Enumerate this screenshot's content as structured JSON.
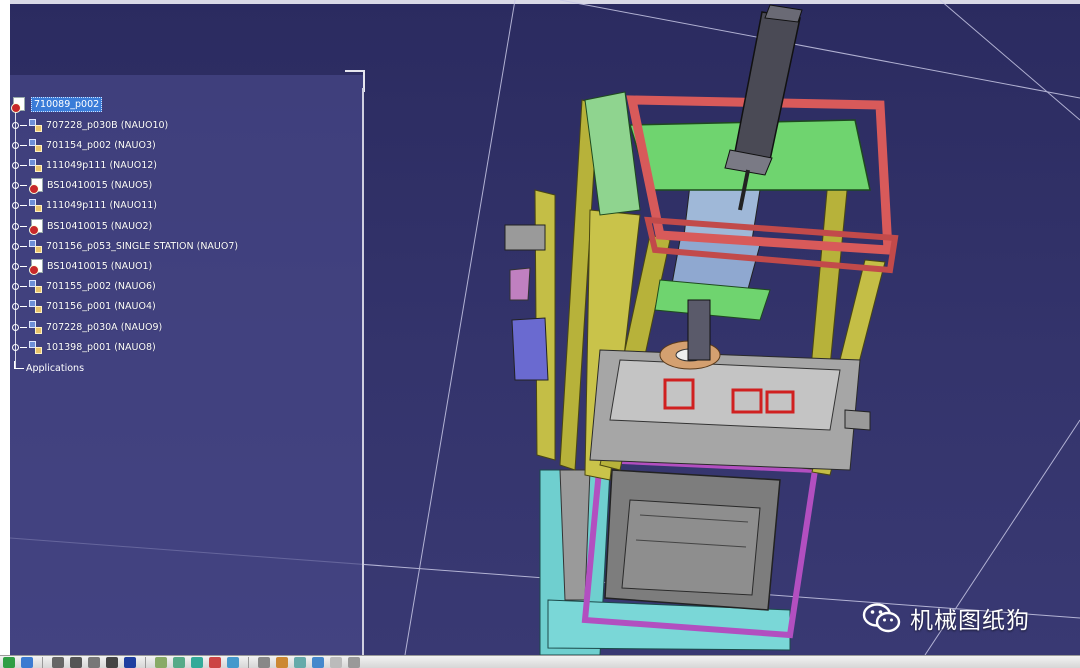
{
  "spec_tree": {
    "root": {
      "label": "710089_p002",
      "icon": "product-icon",
      "selected": true
    },
    "items": [
      {
        "label": "707228_p030B (NAUO10)",
        "icon": "part-icon"
      },
      {
        "label": "701154_p002 (NAUO3)",
        "icon": "part-icon"
      },
      {
        "label": "111049p111 (NAUO12)",
        "icon": "part-icon"
      },
      {
        "label": "BS10410015 (NAUO5)",
        "icon": "product-icon"
      },
      {
        "label": "111049p111 (NAUO11)",
        "icon": "part-icon"
      },
      {
        "label": "BS10410015 (NAUO2)",
        "icon": "product-icon"
      },
      {
        "label": "701156_p053_SINGLE STATION (NAUO7)",
        "icon": "part-icon"
      },
      {
        "label": "BS10410015 (NAUO1)",
        "icon": "product-icon"
      },
      {
        "label": "701155_p002 (NAUO6)",
        "icon": "part-icon"
      },
      {
        "label": "701156_p001 (NAUO4)",
        "icon": "part-icon"
      },
      {
        "label": "707228_p030A (NAUO9)",
        "icon": "part-icon"
      },
      {
        "label": "101398_p001 (NAUO8)",
        "icon": "part-icon"
      }
    ],
    "applications": "Applications"
  },
  "viewport": {
    "background": "#2f2f66",
    "model": "machine-assembly-3d-model",
    "frame_colors": {
      "top_frame": "#d85a5a",
      "left_frame": "#b7b23a",
      "right_frame": "#b7b23a",
      "top_plate": "#6fd46f",
      "base": "#5ac4c4",
      "lower_frame": "#b24fc0",
      "box": "#8a8a8a"
    }
  },
  "toolbar": {
    "icons": [
      "compass-icon",
      "fit-all-icon",
      "pan-icon",
      "rotate-icon",
      "zoom-in-icon",
      "zoom-out-icon",
      "normal-view-icon",
      "multi-view-icon",
      "iso-view-icon",
      "shading-icon",
      "hide-show-icon",
      "swap-visible-icon",
      "measure-icon",
      "section-icon",
      "material-icon",
      "render-icon",
      "camera-icon",
      "snapshot-icon"
    ]
  },
  "watermark": {
    "text": "机械图纸狗",
    "icon": "wechat-icon"
  }
}
